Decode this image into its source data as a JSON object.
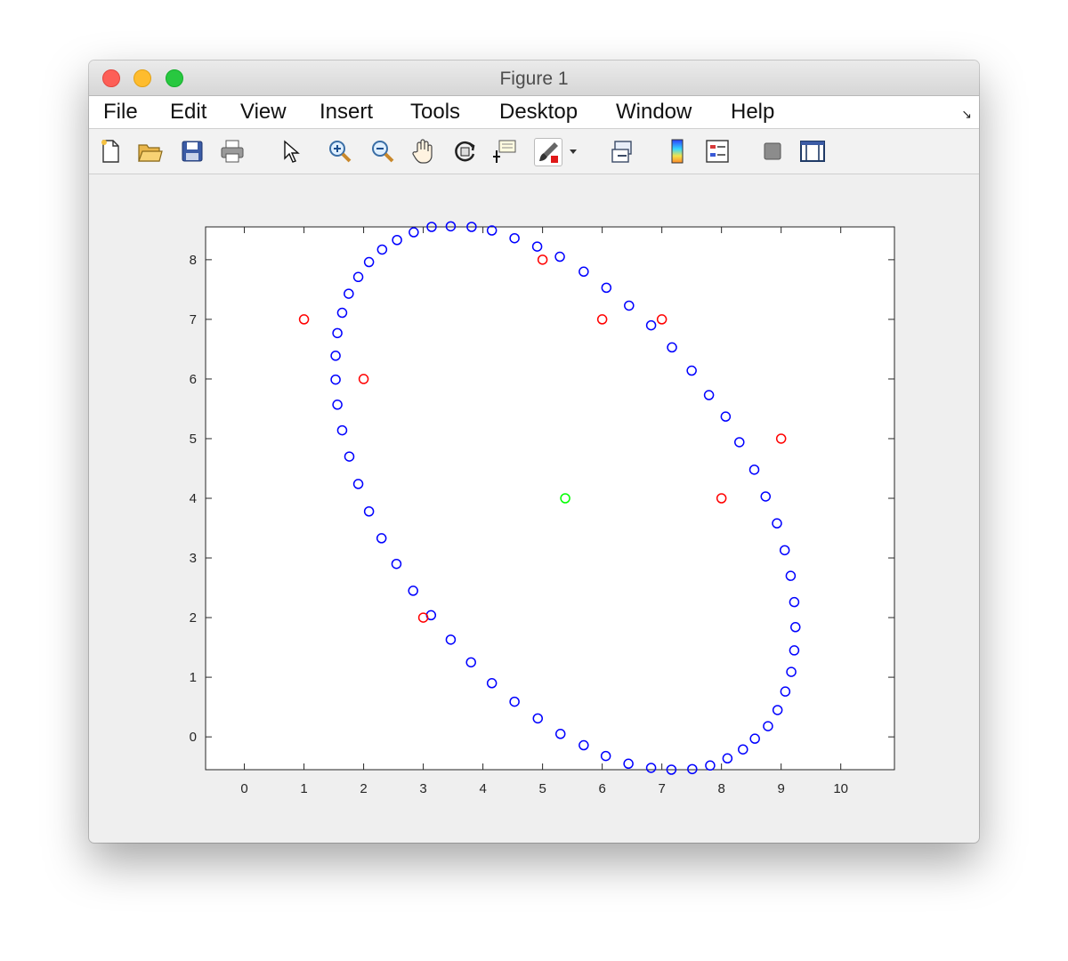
{
  "window": {
    "title": "Figure 1"
  },
  "menu": [
    "File",
    "Edit",
    "View",
    "Insert",
    "Tools",
    "Desktop",
    "Window",
    "Help"
  ],
  "toolbar": {
    "icons": [
      "new-figure-icon",
      "open-file-icon",
      "save-icon",
      "print-icon",
      "edit-plot-arrow-icon",
      "zoom-in-icon",
      "zoom-out-icon",
      "pan-hand-icon",
      "rotate-3d-icon",
      "data-cursor-icon",
      "brush-icon",
      "brush-dropdown-icon",
      "link-plot-icon",
      "colorbar-icon",
      "legend-icon",
      "hide-plot-tools-icon",
      "show-plot-tools-icon"
    ]
  },
  "chart_data": {
    "type": "scatter",
    "xlim": [
      -0.65,
      10.9
    ],
    "ylim": [
      -0.55,
      8.55
    ],
    "xticks": [
      0,
      1,
      2,
      3,
      4,
      5,
      6,
      7,
      8,
      9,
      10
    ],
    "yticks": [
      0,
      1,
      2,
      3,
      4,
      5,
      6,
      7,
      8
    ],
    "grid": false,
    "marker": "circle-open",
    "series": [
      {
        "color": "#0000ff",
        "points": [
          [
            3.46,
            8.56
          ],
          [
            3.81,
            8.55
          ],
          [
            4.15,
            8.49
          ],
          [
            4.53,
            8.36
          ],
          [
            4.91,
            8.22
          ],
          [
            5.29,
            8.05
          ],
          [
            5.69,
            7.8
          ],
          [
            6.07,
            7.53
          ],
          [
            6.45,
            7.23
          ],
          [
            6.82,
            6.9
          ],
          [
            7.17,
            6.53
          ],
          [
            7.5,
            6.14
          ],
          [
            7.79,
            5.73
          ],
          [
            8.07,
            5.37
          ],
          [
            8.3,
            4.94
          ],
          [
            8.55,
            4.48
          ],
          [
            8.74,
            4.03
          ],
          [
            8.93,
            3.58
          ],
          [
            9.06,
            3.13
          ],
          [
            9.16,
            2.7
          ],
          [
            9.22,
            2.26
          ],
          [
            9.24,
            1.84
          ],
          [
            9.22,
            1.45
          ],
          [
            9.17,
            1.09
          ],
          [
            9.07,
            0.76
          ],
          [
            8.94,
            0.45
          ],
          [
            8.78,
            0.18
          ],
          [
            8.56,
            -0.03
          ],
          [
            8.36,
            -0.21
          ],
          [
            8.1,
            -0.36
          ],
          [
            7.81,
            -0.48
          ],
          [
            7.51,
            -0.54
          ],
          [
            7.16,
            -0.55
          ],
          [
            6.82,
            -0.52
          ],
          [
            6.44,
            -0.45
          ],
          [
            6.06,
            -0.32
          ],
          [
            5.69,
            -0.14
          ],
          [
            5.3,
            0.05
          ],
          [
            4.92,
            0.31
          ],
          [
            4.53,
            0.59
          ],
          [
            4.15,
            0.9
          ],
          [
            3.8,
            1.25
          ],
          [
            3.46,
            1.63
          ],
          [
            3.13,
            2.04
          ],
          [
            2.83,
            2.45
          ],
          [
            2.55,
            2.9
          ],
          [
            2.3,
            3.33
          ],
          [
            2.09,
            3.78
          ],
          [
            1.91,
            4.24
          ],
          [
            1.76,
            4.7
          ],
          [
            1.64,
            5.14
          ],
          [
            1.56,
            5.57
          ],
          [
            1.53,
            5.99
          ],
          [
            1.53,
            6.39
          ],
          [
            1.56,
            6.77
          ],
          [
            1.64,
            7.11
          ],
          [
            1.75,
            7.43
          ],
          [
            1.91,
            7.71
          ],
          [
            2.09,
            7.96
          ],
          [
            2.31,
            8.17
          ],
          [
            2.56,
            8.33
          ],
          [
            2.84,
            8.46
          ],
          [
            3.14,
            8.55
          ]
        ]
      },
      {
        "color": "#ff0000",
        "points": [
          [
            1,
            7
          ],
          [
            2,
            6
          ],
          [
            3,
            2
          ],
          [
            5,
            8
          ],
          [
            6,
            7
          ],
          [
            7,
            7
          ],
          [
            8,
            4
          ],
          [
            9,
            5
          ]
        ]
      },
      {
        "color": "#00ff00",
        "points": [
          [
            5.38,
            4
          ]
        ]
      }
    ]
  }
}
